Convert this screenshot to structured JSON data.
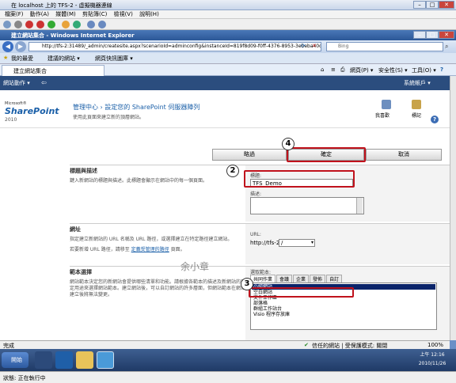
{
  "vm_window": {
    "title": "在 localhost 上的 TFS-2 - 虛擬機器連線",
    "menu": [
      "檔案(F)",
      "動作(A)",
      "媒體(M)",
      "剪貼簿(C)",
      "檢視(V)",
      "說明(H)"
    ]
  },
  "ie": {
    "title": "建立網站集合 - Windows Internet Explorer",
    "address": "http://tfs-2:31489/_admin/createsite.aspx?scenarioId=adminconfig&instanceId=819f8d09-f0ff-4376-8953-3ebeba40d8c7",
    "search_placeholder": "Bing",
    "favorites": {
      "label": "我的最愛",
      "items": [
        "建議的網站 ▾",
        "網頁快訊圖庫 ▾"
      ]
    },
    "tab_label": "建立網站集合",
    "commands": [
      "網頁(P) ▾",
      "安全性(S) ▾",
      "工具(O) ▾"
    ],
    "status_left": "完成",
    "status_zone": "信任的網站 | 受保護模式: 關閉",
    "zoom": "100%"
  },
  "sharepoint": {
    "ribbon": {
      "site_actions": "網站動作 ▾",
      "user": "系統帳戶 ▾"
    },
    "logo": {
      "ms": "Microsoft®",
      "sp": "SharePoint",
      "year": "2010"
    },
    "breadcrumb_root": "管理中心",
    "breadcrumb_page": "設定您的 SharePoint 伺服器陣列",
    "page_desc": "使用此頁面來建立新的頂層網站。",
    "header_icons": {
      "like": "我喜歡",
      "tags": "標記"
    },
    "buttons": {
      "back": "略過",
      "ok": "確定",
      "cancel": "取消"
    },
    "title_section": {
      "heading": "標題與描述",
      "desc": "鍵入新網站的標題與描述。此標題會顯示在網站中的每一個頁面。",
      "title_label": "標題:",
      "title_value": "TFS_Demo",
      "desc_label": "描述:"
    },
    "url_section": {
      "heading": "網址",
      "desc1": "指定建立新網站的 URL 名稱及 URL 路徑，或選擇建立在特定路徑建立網站。",
      "desc2_pre": "若要新增 URL 路徑，請移至",
      "desc2_link": "定義受管理的路徑",
      "desc2_post": "頁面。",
      "label": "URL:",
      "prefix": "http://tfs-2",
      "path_value": "/"
    },
    "template_section": {
      "heading": "範本選擇",
      "desc": "網站範本決定您的新網站會提供哪些清單和功能。請根據各範本的描述及新網站的預定用途來選擇網站範本。建立網站後，可以自訂網站的許多層面，但網站範本在網站建立後將無法變更。",
      "label": "選取範本:",
      "tabs": [
        "共同作業",
        "會議",
        "企業",
        "發佈",
        "自訂"
      ],
      "templates": [
        "小組網站",
        "空白網站",
        "文件工作區",
        "部落格",
        "群組工作站台",
        "Visio 程序存放庫"
      ]
    }
  },
  "annotations": {
    "callouts": [
      "2",
      "3",
      "4"
    ],
    "watermark": "余小章"
  },
  "taskbar": {
    "start": "開始",
    "time": "上午 12:16",
    "date": "2010/11/26"
  },
  "vm_status": "狀態: 正在執行中"
}
